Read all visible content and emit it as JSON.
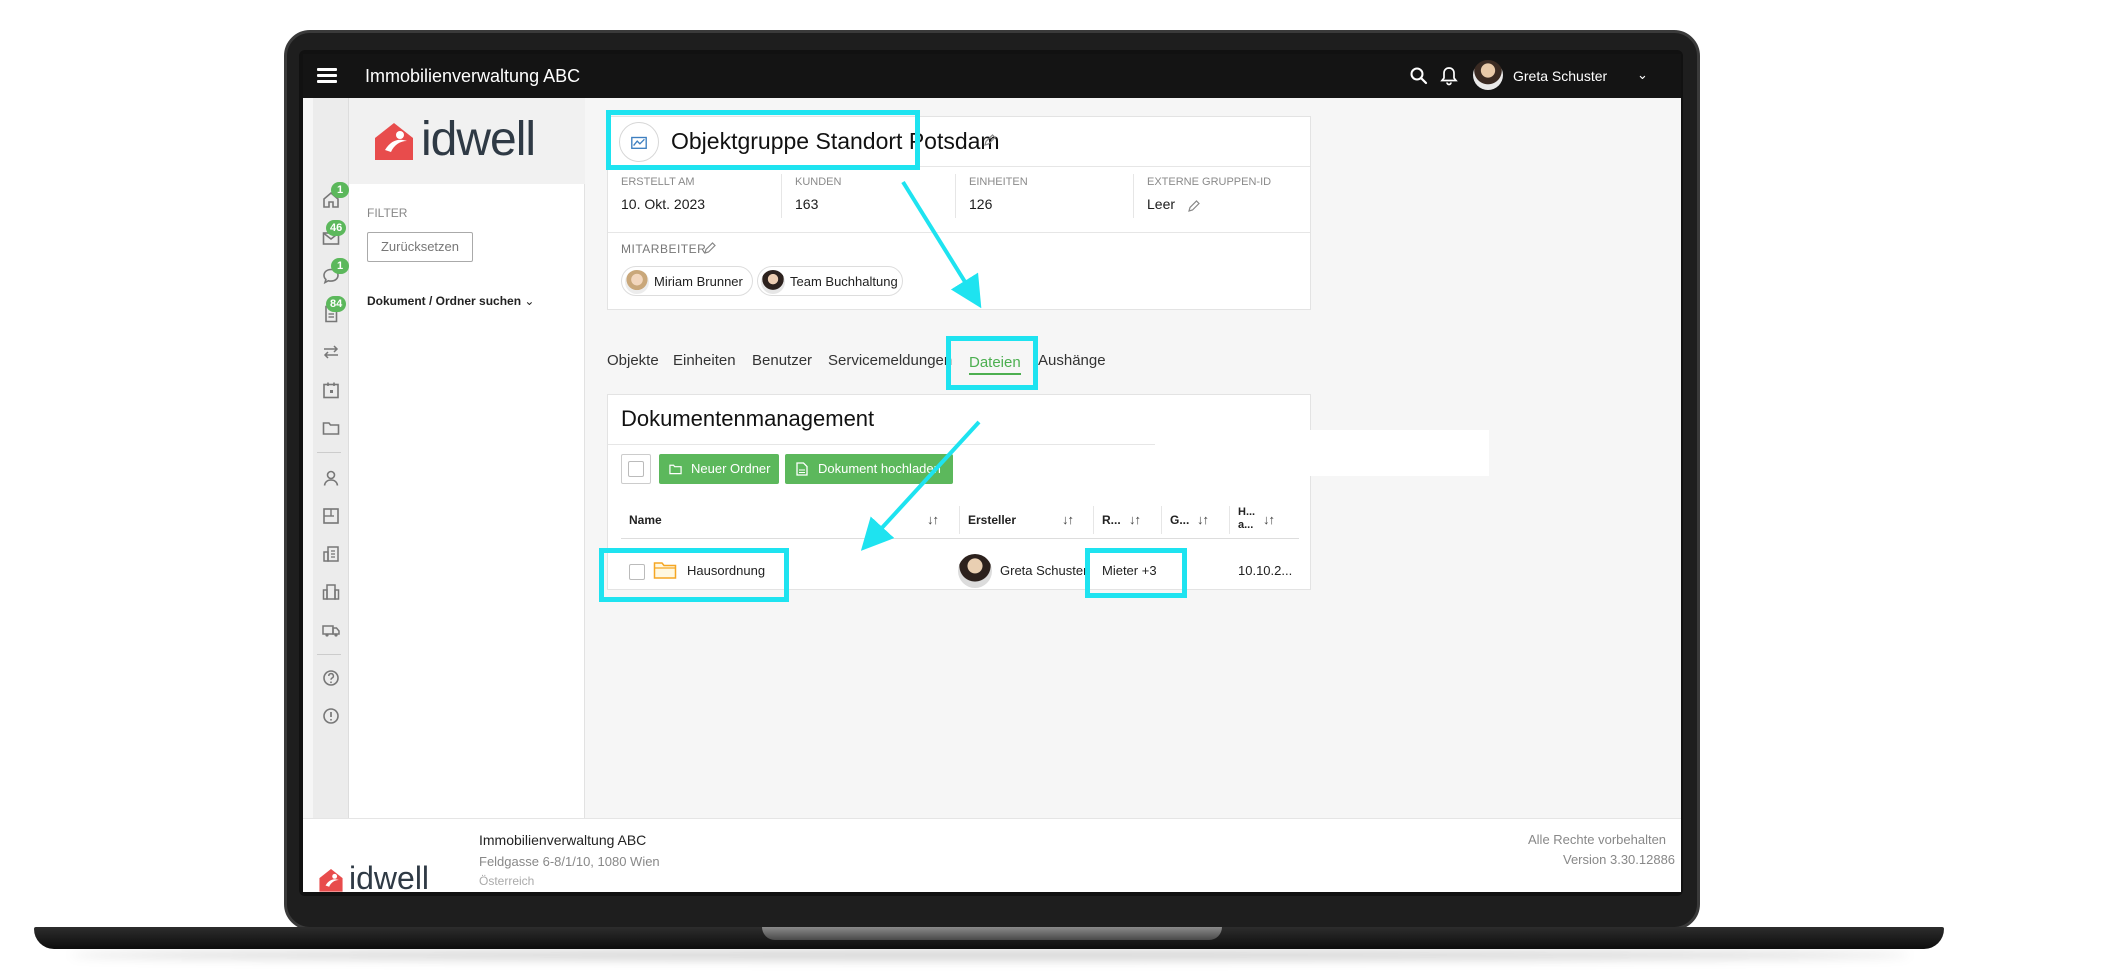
{
  "app": {
    "title": "Immobilienverwaltung ABC",
    "user_name": "Greta Schuster"
  },
  "brand": {
    "logo_text": "idwell",
    "accent": "#4caf50",
    "logo_red": "#e84c4c",
    "highlight": "#1ee3f0"
  },
  "rail": {
    "badges": {
      "home": "1",
      "mail": "46",
      "chat": "1",
      "docs": "84"
    }
  },
  "filter": {
    "label": "FILTER",
    "reset": "Zurücksetzen",
    "doc_search": "Dokument / Ordner suchen"
  },
  "group": {
    "title": "Objektgruppe Standort Potsdam",
    "meta": [
      {
        "label": "ERSTELLT AM",
        "value": "10. Okt. 2023"
      },
      {
        "label": "KUNDEN",
        "value": "163"
      },
      {
        "label": "EINHEITEN",
        "value": "126"
      },
      {
        "label": "EXTERNE GRUPPEN-ID",
        "value": "Leer"
      }
    ],
    "staff_label": "MITARBEITER",
    "staff": [
      "Miriam Brunner",
      "Team Buchhaltung"
    ]
  },
  "tabs": [
    "Objekte",
    "Einheiten",
    "Benutzer",
    "Servicemeldungen",
    "Dateien",
    "Aushänge"
  ],
  "active_tab": "Dateien",
  "docs": {
    "title": "Dokumentenmanagement",
    "new_folder": "Neuer Ordner",
    "upload": "Dokument hochladen",
    "columns": [
      "Name",
      "Ersteller",
      "R...",
      "G...",
      "H... a..."
    ],
    "rows": [
      {
        "name": "Hausordnung",
        "creator": "Greta Schuster",
        "roles": "Mieter +3",
        "date": "10.10.2..."
      }
    ]
  },
  "footer": {
    "company": "Immobilienverwaltung ABC",
    "address": "Feldgasse 6-8/1/10, 1080 Wien",
    "address2": "Österreich",
    "rights": "Alle Rechte vorbehalten",
    "version": "Version 3.30.12886"
  }
}
